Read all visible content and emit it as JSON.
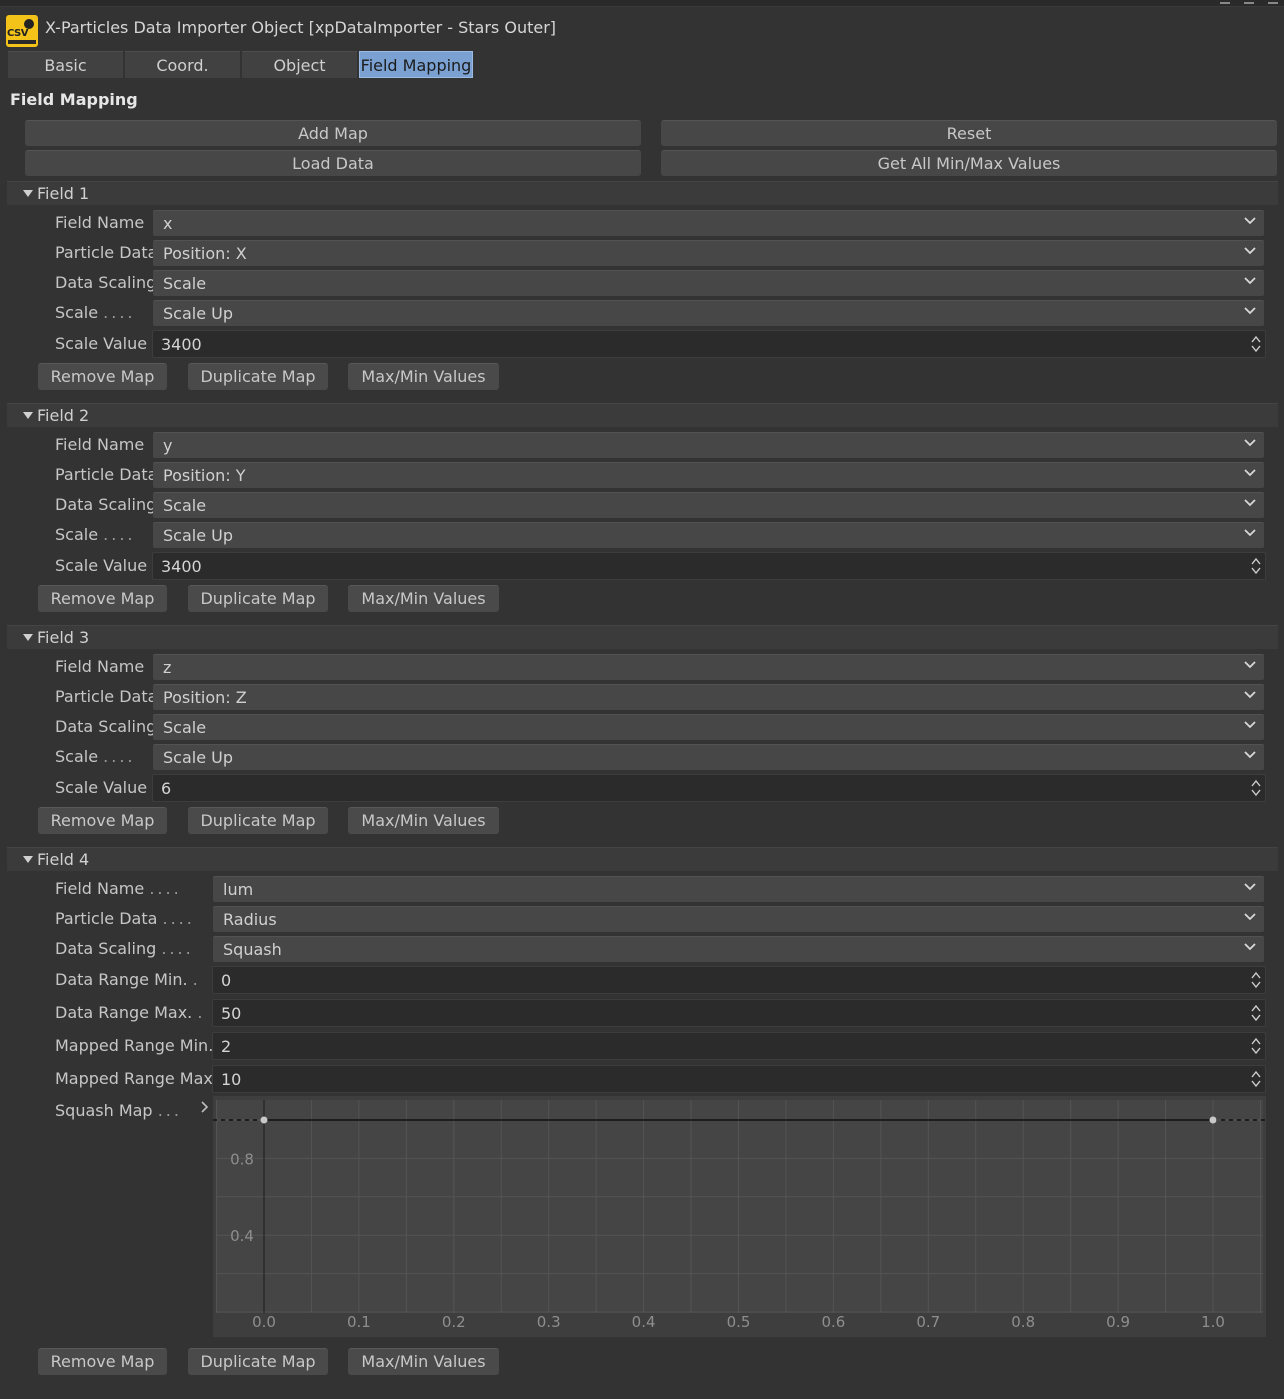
{
  "window": {
    "title": "X-Particles Data Importer Object [xpDataImporter - Stars Outer]",
    "icon_text": "CSV"
  },
  "tabs": [
    {
      "label": "Basic",
      "active": false
    },
    {
      "label": "Coord.",
      "active": false
    },
    {
      "label": "Object",
      "active": false
    },
    {
      "label": "Field Mapping",
      "active": true
    }
  ],
  "section": {
    "title": "Field Mapping"
  },
  "actions": {
    "add_map": "Add Map",
    "reset": "Reset",
    "load_data": "Load Data",
    "get_minmax": "Get All Min/Max Values"
  },
  "row_buttons": {
    "remove": "Remove Map",
    "duplicate": "Duplicate Map",
    "maxmin": "Max/Min Values"
  },
  "labels": {
    "field_name": "Field Name",
    "particle_data": "Particle Data",
    "data_scaling": "Data Scaling",
    "scale": "Scale",
    "scale_value": "Scale Value",
    "data_range_min": "Data Range Min.",
    "data_range_max": "Data Range Max.",
    "mapped_range_min": "Mapped Range Min.",
    "mapped_range_max": "Mapped Range Max.",
    "squash_map": "Squash Map"
  },
  "fields": [
    {
      "title": "Field 1",
      "field_name": "x",
      "particle_data": "Position: X",
      "data_scaling": "Scale",
      "scale": "Scale Up",
      "scale_value": "3400"
    },
    {
      "title": "Field 2",
      "field_name": "y",
      "particle_data": "Position: Y",
      "data_scaling": "Scale",
      "scale": "Scale Up",
      "scale_value": "3400"
    },
    {
      "title": "Field 3",
      "field_name": "z",
      "particle_data": "Position: Z",
      "data_scaling": "Scale",
      "scale": "Scale Up",
      "scale_value": "6"
    },
    {
      "title": "Field 4",
      "field_name": "lum",
      "particle_data": "Radius",
      "data_scaling": "Squash",
      "data_range_min": "0",
      "data_range_max": "50",
      "mapped_range_min": "2",
      "mapped_range_max": "10"
    }
  ],
  "chart_data": {
    "type": "line",
    "x": [
      0.0,
      1.0
    ],
    "y": [
      1.0,
      1.0
    ],
    "x_ticks": [
      "0.0",
      "0.1",
      "0.2",
      "0.3",
      "0.4",
      "0.5",
      "0.6",
      "0.7",
      "0.8",
      "0.9",
      "1.0"
    ],
    "y_ticks": [
      "0.4",
      "0.8"
    ],
    "xlim": [
      0,
      1
    ],
    "ylim": [
      0,
      1
    ],
    "grid": true,
    "colors": {
      "background": "#3e3e3e",
      "plot_bg": "#454545",
      "grid": "#545454",
      "line": "#111111",
      "point": "#c8c8c8"
    }
  }
}
